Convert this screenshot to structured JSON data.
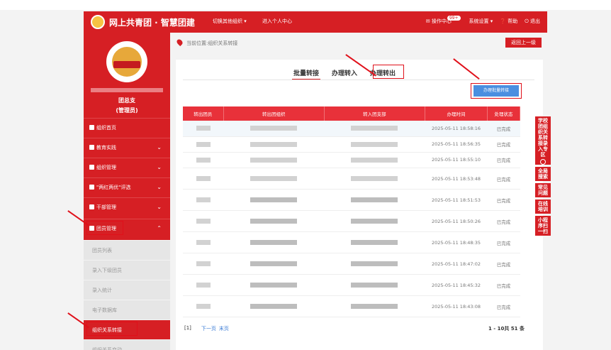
{
  "topbar": {
    "brand": "网上共青团 · 智慧团建",
    "switch_label": "切换其他组织 ▾",
    "center_label": "进入个人中心",
    "task_label": "操作中心",
    "task_badge": "99+",
    "settings_label": "系统设置 ▾",
    "help_label": "帮助",
    "exit_label": "退出"
  },
  "sidebar": {
    "org_name": "团总支",
    "role": "(管理员)",
    "items": [
      {
        "label": "组织首页",
        "icon": "home-icon",
        "chevron": ""
      },
      {
        "label": "教育实践",
        "icon": "book-icon",
        "chevron": "⌄"
      },
      {
        "label": "组织管理",
        "icon": "org-icon",
        "chevron": "⌄"
      },
      {
        "label": "\"两红两优\"评选",
        "icon": "award-icon",
        "chevron": "⌄"
      },
      {
        "label": "干部管理",
        "icon": "people-icon",
        "chevron": "⌄"
      },
      {
        "label": "团员管理",
        "icon": "member-icon",
        "chevron": "⌃"
      }
    ],
    "subitems": [
      {
        "label": "团员列表"
      },
      {
        "label": "录入下级团员"
      },
      {
        "label": "录入统计"
      },
      {
        "label": "电子数据库"
      },
      {
        "label": "组织关系转接"
      },
      {
        "label": "组织关系变动"
      }
    ]
  },
  "breadcrumb": "当前位置:组织关系转接",
  "back_button": "返回上一级",
  "tabs": [
    {
      "label": "批量转接"
    },
    {
      "label": "办理转入"
    },
    {
      "label": "办理转出"
    }
  ],
  "batch_button": "办理批量转接",
  "table": {
    "headers": [
      "转出团员",
      "转出团组织",
      "转入团支部",
      "办理时间",
      "处理状态"
    ],
    "rows": [
      {
        "time": "2025-05-11 18:58:16",
        "status": "已完成"
      },
      {
        "time": "2025-05-11 18:56:35",
        "status": "已完成"
      },
      {
        "time": "2025-05-11 18:55:10",
        "status": "已完成"
      },
      {
        "time": "2025-05-11 18:53:48",
        "status": "已完成"
      },
      {
        "time": "2025-05-11 18:51:53",
        "status": "已完成"
      },
      {
        "time": "2025-05-11 18:50:26",
        "status": "已完成"
      },
      {
        "time": "2025-05-11 18:48:35",
        "status": "已完成"
      },
      {
        "time": "2025-05-11 18:47:02",
        "status": "已完成"
      },
      {
        "time": "2025-05-11 18:45:32",
        "status": "已完成"
      },
      {
        "time": "2025-05-11 18:43:08",
        "status": "已完成"
      }
    ]
  },
  "pager": {
    "current": "[1]",
    "next": "下一页",
    "last": "末页",
    "total": "1 - 10共 51 条"
  },
  "side_tools": [
    {
      "label": "学校团组织关系转接录入专区"
    },
    {
      "label": "全局搜索"
    },
    {
      "label": "常见问题"
    },
    {
      "label": "在线培训"
    },
    {
      "label": "小程序扫一扫"
    }
  ],
  "colors": {
    "brand_red": "#d61f24",
    "accent_blue": "#4a8fe0",
    "highlight": "#e0101a"
  }
}
